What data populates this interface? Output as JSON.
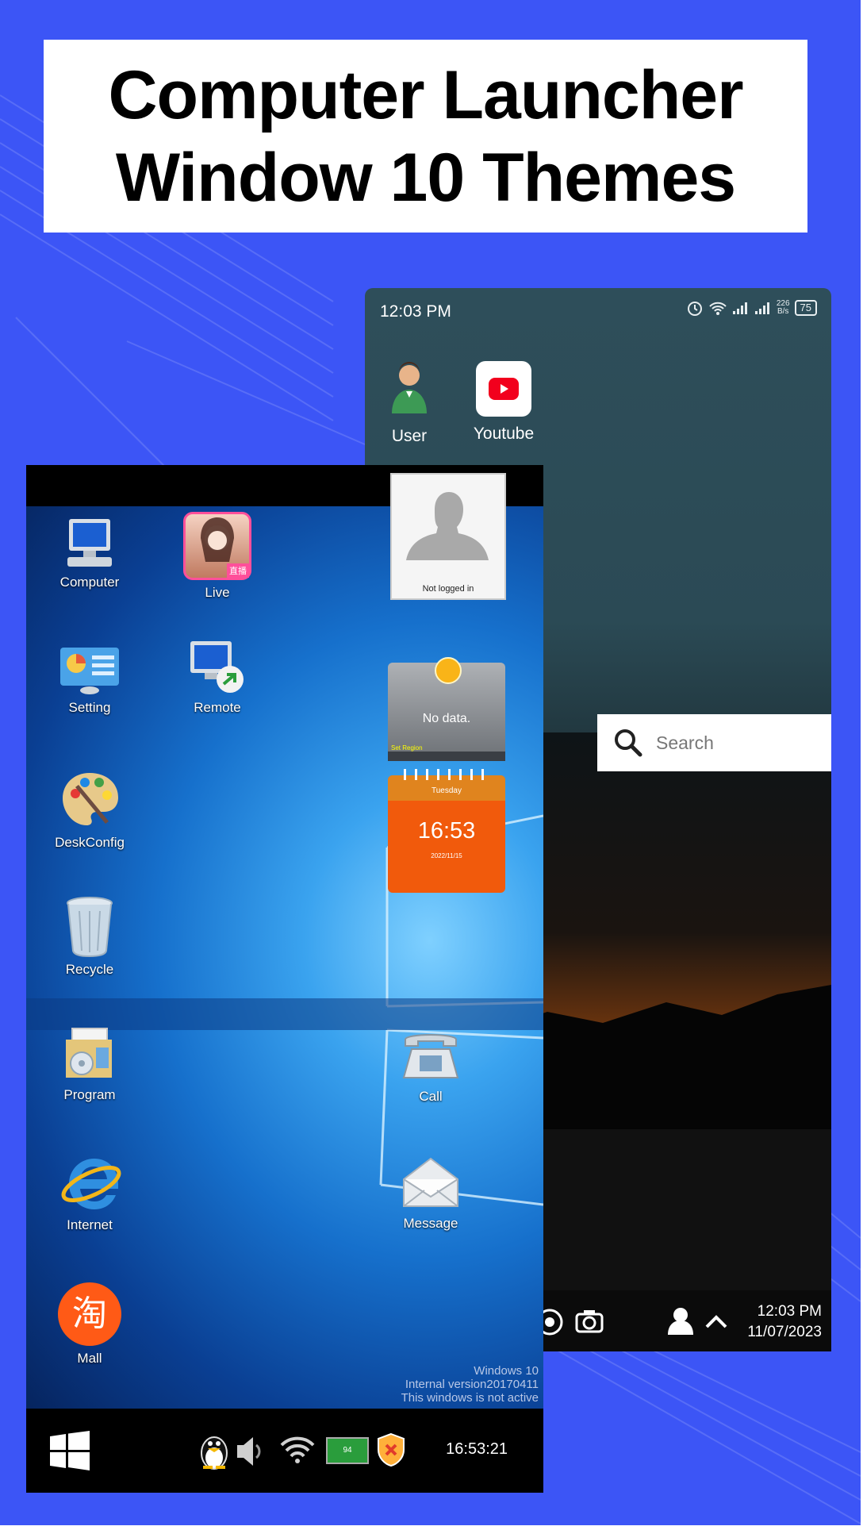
{
  "promo": {
    "title_line1": "Computer Launcher",
    "title_line2": "Window 10 Themes",
    "bg_color": "#3c55f6"
  },
  "back_phone": {
    "status_time": "12:03 PM",
    "status_icons": [
      "alarm-icon",
      "wifi-icon",
      "signal-icon",
      "signal-icon"
    ],
    "net_speed_value": "226",
    "net_speed_unit": "B/s",
    "battery": "75",
    "apps": [
      {
        "label": "User",
        "icon": "user-avatar-icon"
      },
      {
        "label": "Youtube",
        "icon": "youtube-icon"
      }
    ],
    "search_placeholder": "Search",
    "taskbar_icons": [
      "chrome-icon",
      "camera-icon",
      "user-icon",
      "chevron-up-icon"
    ],
    "clock_time": "12:03 PM",
    "clock_date": "11/07/2023"
  },
  "win_launcher": {
    "desktop_icons_left": [
      {
        "label": "Computer",
        "icon": "computer-icon"
      },
      {
        "label": "Setting",
        "icon": "control-panel-icon"
      },
      {
        "label": "DeskConfig",
        "icon": "paint-palette-icon"
      },
      {
        "label": "Recycle",
        "icon": "recycle-bin-icon"
      },
      {
        "label": "Program",
        "icon": "program-files-icon"
      },
      {
        "label": "Internet",
        "icon": "internet-explorer-icon"
      },
      {
        "label": "Mall",
        "icon": "taobao-mall-icon"
      }
    ],
    "desktop_icons_mid": [
      {
        "label": "Live",
        "icon": "live-stream-icon",
        "badge": "直播"
      },
      {
        "label": "Remote",
        "icon": "remote-desktop-icon"
      }
    ],
    "desktop_icons_right": [
      {
        "label": "Call",
        "icon": "telephone-icon"
      },
      {
        "label": "Message",
        "icon": "envelope-icon"
      }
    ],
    "profile_widget": {
      "status": "Not logged in"
    },
    "weather_widget": {
      "text": "No data.",
      "link": "Set Region"
    },
    "calendar_widget": {
      "day": "Tuesday",
      "time": "16:53",
      "date": "2022/11/15"
    },
    "watermark": [
      "Windows 10",
      "Internal version20170411",
      "This windows is not active"
    ],
    "tray": {
      "icons": [
        "start-windows-icon",
        "qq-penguin-icon",
        "speaker-icon",
        "wifi-icon",
        "battery-icon",
        "security-shield-icon"
      ],
      "battery_level": "94",
      "clock": "16:53:21"
    }
  }
}
